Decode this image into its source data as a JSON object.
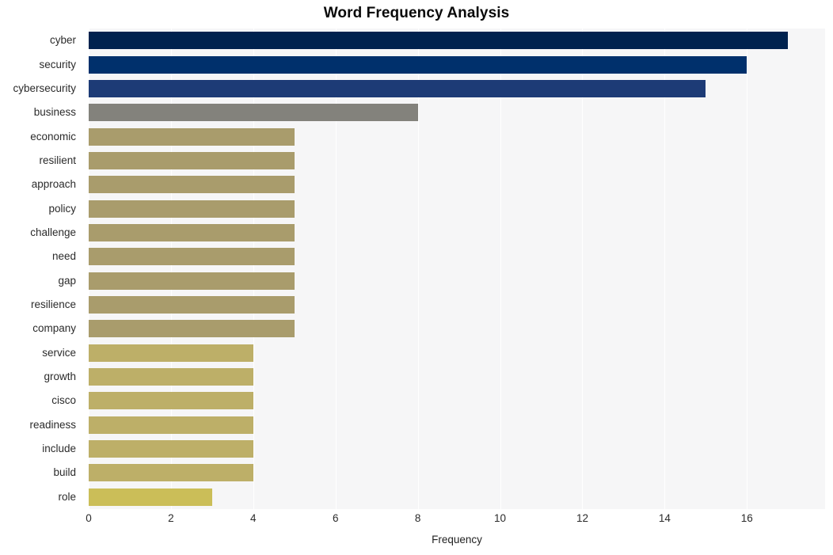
{
  "chart_data": {
    "type": "bar",
    "orientation": "horizontal",
    "title": "Word Frequency Analysis",
    "xlabel": "Frequency",
    "ylabel": "",
    "categories": [
      "cyber",
      "security",
      "cybersecurity",
      "business",
      "economic",
      "resilient",
      "approach",
      "policy",
      "challenge",
      "need",
      "gap",
      "resilience",
      "company",
      "service",
      "growth",
      "cisco",
      "readiness",
      "include",
      "build",
      "role"
    ],
    "values": [
      17,
      16,
      15,
      8,
      5,
      5,
      5,
      5,
      5,
      5,
      5,
      5,
      5,
      4,
      4,
      4,
      4,
      4,
      4,
      3
    ],
    "bar_colors": [
      "#00224e",
      "#00306c",
      "#1d3b76",
      "#83827c",
      "#a99c6c",
      "#a99c6c",
      "#a99c6c",
      "#a99c6c",
      "#a99c6c",
      "#a99c6c",
      "#a99c6c",
      "#a99c6c",
      "#a99c6c",
      "#bdaf68",
      "#bdaf68",
      "#bdaf68",
      "#bdaf68",
      "#bdaf68",
      "#bdaf68",
      "#cbbe58"
    ],
    "xlim": [
      0,
      17.9
    ],
    "xticks": [
      0,
      2,
      4,
      6,
      8,
      10,
      12,
      14,
      16
    ],
    "xtick_labels": [
      "0",
      "2",
      "4",
      "6",
      "8",
      "10",
      "12",
      "14",
      "16"
    ],
    "grid": "vertical-white-on-gray",
    "legend": null,
    "plot_background": "#f6f6f7",
    "figure_background": "#ffffff",
    "title_color": "#0a0a0a",
    "tick_color": "#2b2b2b"
  }
}
